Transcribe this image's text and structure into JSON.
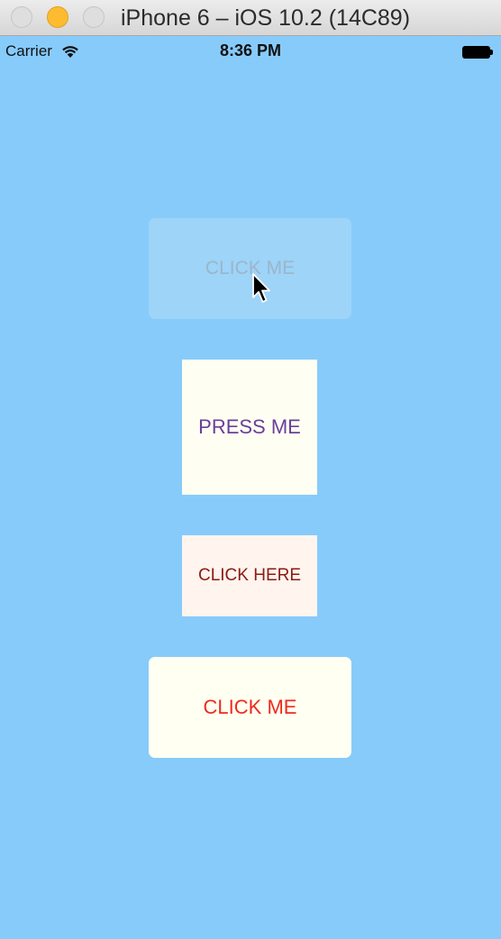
{
  "window": {
    "title": "iPhone 6 – iOS 10.2 (14C89)"
  },
  "status_bar": {
    "carrier": "Carrier",
    "time": "8:36 PM",
    "wifi_icon": "wifi-icon",
    "battery_icon": "battery-icon",
    "battery_level": 1.0
  },
  "buttons": [
    {
      "label": "CLICK ME",
      "state": "pressed",
      "background": "#9dd4f8",
      "text_color": "#9cb5ca"
    },
    {
      "label": "PRESS ME",
      "background": "#fffef2",
      "text_color": "#6a3f9a"
    },
    {
      "label": "CLICK HERE",
      "background": "#fff5ee",
      "text_color": "#8b1a12"
    },
    {
      "label": "CLICK ME",
      "background": "#fffff2",
      "text_color": "#ee2b1f"
    }
  ],
  "colors": {
    "screen_background": "#87cbfb"
  }
}
